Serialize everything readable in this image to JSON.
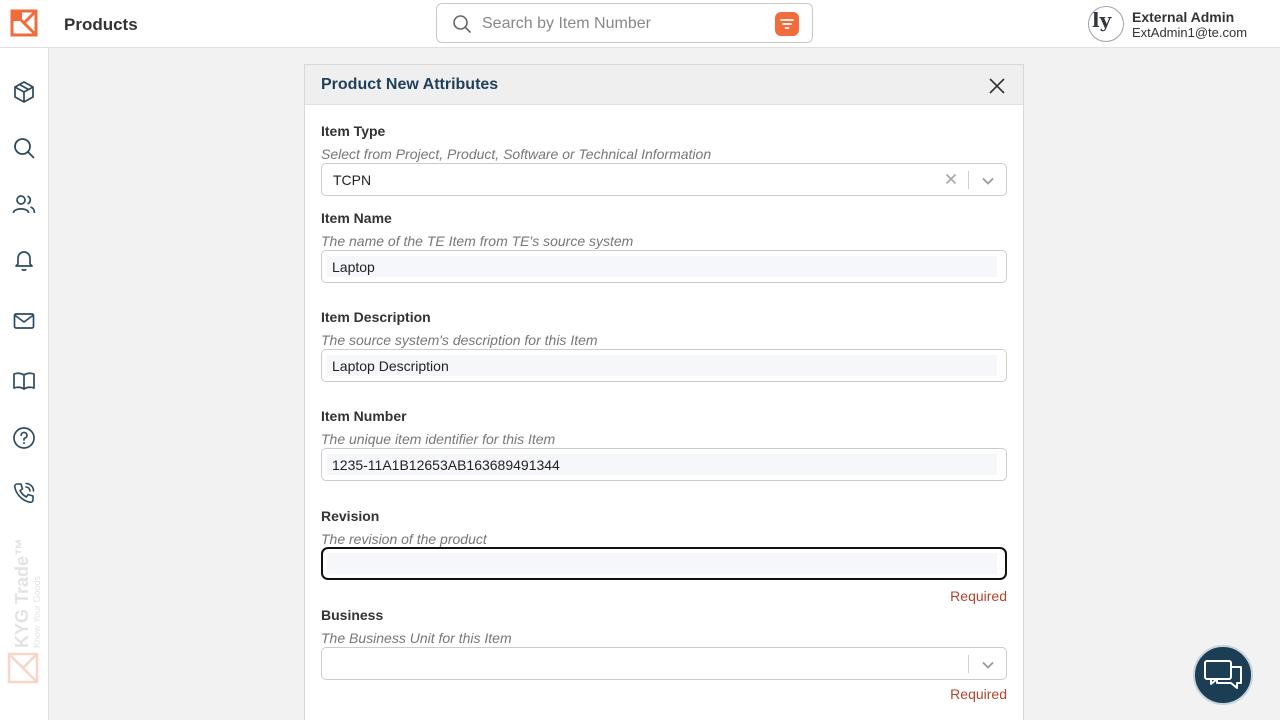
{
  "app": {
    "title": "Products",
    "brand_color": "#f26b3a",
    "watermark_text": "KYG Trade™",
    "watermark_tagline": "Know Your Goods"
  },
  "search": {
    "placeholder": "Search by Item Number",
    "value": ""
  },
  "user": {
    "name": "External Admin",
    "email": "ExtAdmin1@te.com",
    "avatar_text": "ly"
  },
  "sidebar": {
    "items": [
      {
        "icon": "cube-icon",
        "label": "Products"
      },
      {
        "icon": "search-icon",
        "label": "Search"
      },
      {
        "icon": "users-icon",
        "label": "Users"
      },
      {
        "icon": "bell-icon",
        "label": "Notifications"
      },
      {
        "icon": "mail-icon",
        "label": "Messages"
      },
      {
        "icon": "book-icon",
        "label": "Documentation"
      },
      {
        "icon": "help-icon",
        "label": "Help"
      },
      {
        "icon": "phone-icon",
        "label": "Contact"
      }
    ]
  },
  "modal": {
    "title": "Product New Attributes",
    "fields": {
      "item_type": {
        "label": "Item Type",
        "help": "Select from Project, Product, Software or Technical Information",
        "value": "TCPN"
      },
      "item_name": {
        "label": "Item Name",
        "help": "The name of the TE Item from TE's source system",
        "value": "Laptop"
      },
      "item_description": {
        "label": "Item Description",
        "help": "The source system's description for this Item",
        "value": "Laptop Description"
      },
      "item_number": {
        "label": "Item Number",
        "help": "The unique item identifier for this Item",
        "value": "1235-11A1B12653AB163689491344"
      },
      "revision": {
        "label": "Revision",
        "help": "The revision of the product",
        "value": "",
        "error": "Required"
      },
      "business": {
        "label": "Business",
        "help": "The Business Unit for this Item",
        "value": "",
        "error": "Required"
      }
    }
  },
  "colors": {
    "accent": "#f26b3a",
    "title": "#1f3f5a",
    "error": "#b5432c",
    "chat": "#1b3e55"
  }
}
